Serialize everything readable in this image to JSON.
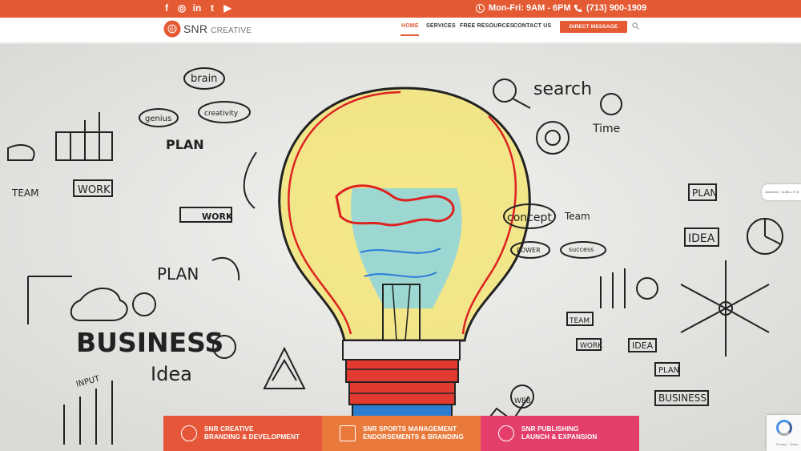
{
  "topbar": {
    "social": [
      "f",
      "◎",
      "in",
      "t",
      "▶"
    ],
    "social_names": [
      "facebook-icon",
      "instagram-icon",
      "linkedin-icon",
      "twitter-icon",
      "youtube-icon"
    ],
    "hours": "Mon-Fri: 9AM - 6PM",
    "phone": "(713) 900-1909"
  },
  "brand": {
    "name": "SNR",
    "suffix": "CREATIVE"
  },
  "nav": {
    "items": [
      "HOME",
      "SERVICES",
      "FREE RESOURCES",
      "CONTACT US"
    ],
    "cta": "DIRECT MESSAGE"
  },
  "hero": {
    "words": {
      "brain": "brain",
      "creativity": "creativity",
      "genius": "genius",
      "plan": "PLAN",
      "team": "TEAM",
      "work": "WORK",
      "work2": "WORK",
      "plan2": "PLAN",
      "business": "BUSINESS",
      "idea": "Idea",
      "search": "search",
      "time": "Time",
      "concept": "concept",
      "team2": "Team",
      "power": "POWER",
      "success": "success",
      "plan3": "PLAN",
      "idea2": "IDEA",
      "team3": "TEAM",
      "work3": "WORK",
      "idea3": "IDEA",
      "plan4": "PLAN",
      "business2": "BUSINESS",
      "web": "WEB",
      "input": "INPUT"
    }
  },
  "tiles": [
    {
      "line1": "SNR CREATIVE",
      "line2": "BRANDING & DEVELOPMENT"
    },
    {
      "line1": "SNR SPORTS MANAGEMENT",
      "line2": "ENDORSEMENTS & BRANDING"
    },
    {
      "line1": "SNR PUBLISHING",
      "line2": "LAUNCH & EXPANSION"
    }
  ],
  "widgets": {
    "side_tab": "clicontent · 11/60 c.77.8",
    "recaptcha": "Privacy · Terms"
  },
  "colors": {
    "accent": "#e35a33",
    "tile1": "#e6573a",
    "tile2": "#ea7a3c",
    "tile3": "#e43f6b"
  }
}
